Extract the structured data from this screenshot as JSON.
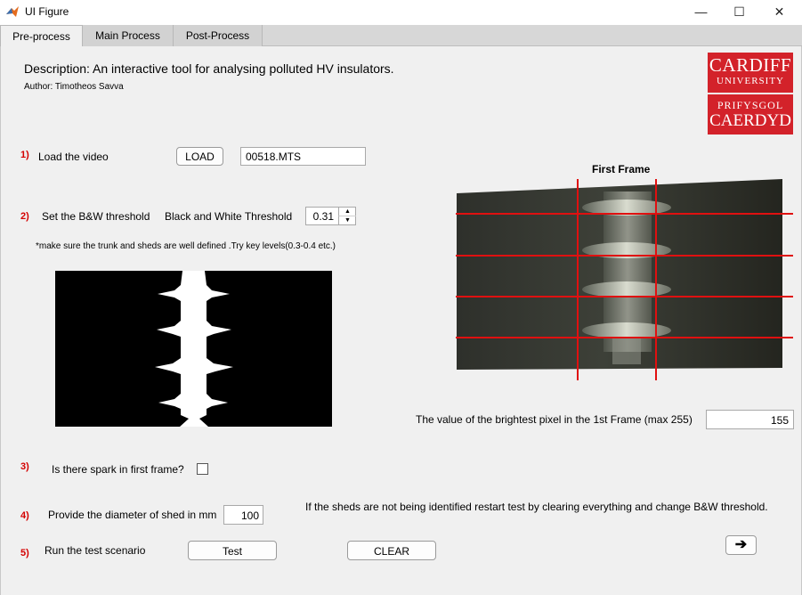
{
  "window": {
    "title": "UI Figure",
    "minimize": "—",
    "maximize": "☐",
    "close": "✕"
  },
  "tabs": [
    {
      "label": "Pre-process"
    },
    {
      "label": "Main Process"
    },
    {
      "label": "Post-Process"
    }
  ],
  "header": {
    "description": "Description: An interactive tool for analysing polluted HV insulators.",
    "author": "Author: Timotheos Savva"
  },
  "logo": {
    "line1": "CARDIFF",
    "line2": "UNIVERSITY",
    "line3": "PRIFYSGOL",
    "line4": "CAERDYD"
  },
  "steps": {
    "s1": {
      "num": "1)",
      "label": "Load the video",
      "button": "LOAD",
      "file_value": "00518.MTS"
    },
    "s2": {
      "num": "2)",
      "label": "Set the B&W threshold",
      "field_label": "Black and White Threshold",
      "threshold": "0.31",
      "hint": "*make sure the trunk and sheds are well defined .Try key levels(0.3-0.4 etc.)"
    },
    "s3": {
      "num": "3)",
      "label": "Is there spark in first frame?",
      "checked": false
    },
    "s4": {
      "num": "4)",
      "label": "Provide the diameter of shed in mm",
      "diameter": "100"
    },
    "s5": {
      "num": "5)",
      "label": "Run the test scenario",
      "test_button": "Test",
      "clear_button": "CLEAR"
    }
  },
  "first_frame": {
    "title": "First Frame"
  },
  "brightest": {
    "label": "The value of the brightest pixel in the 1st Frame (max 255)",
    "value": "155"
  },
  "restart_note": "If the sheds are not being identified restart test by clearing everything and change B&W threshold.",
  "next_arrow": "➔",
  "spinner": {
    "up": "▲",
    "down": "▼"
  }
}
